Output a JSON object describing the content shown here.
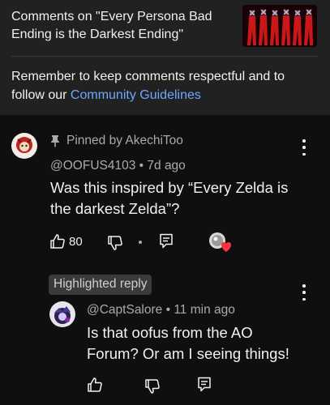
{
  "header": {
    "title": "Comments on \"Every Persona Bad Ending is the Darkest Ending\"",
    "reminder_text": "Remember to keep comments respectful and to follow our ",
    "guidelines_link": "Community Guidelines"
  },
  "comment": {
    "pinned_label": "Pinned by AkechiToo",
    "author": "@OOFUS4103",
    "time": "7d ago",
    "text": "Was this inspired by “Every Zelda is the darkest Zelda”?",
    "like_count": "80"
  },
  "reply": {
    "badge": "Highlighted reply",
    "author": "@CaptSalore",
    "time": "11 min ago",
    "text": "Is that oofus from the AO Forum? Or am I seeing things!"
  },
  "colors": {
    "background": "#0f0f0f",
    "header_background": "#212121",
    "link": "#6fa8ff",
    "secondary_text": "#aaaaaa"
  }
}
